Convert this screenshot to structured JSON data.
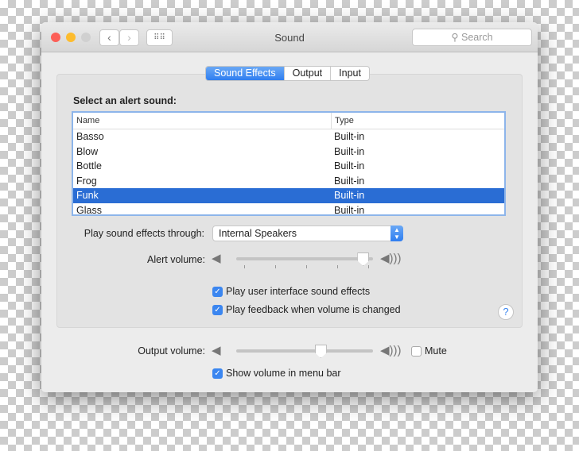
{
  "window": {
    "title": "Sound",
    "search_placeholder": "Search"
  },
  "tabs": [
    {
      "label": "Sound Effects",
      "selected": true
    },
    {
      "label": "Output",
      "selected": false
    },
    {
      "label": "Input",
      "selected": false
    }
  ],
  "alert": {
    "heading": "Select an alert sound:",
    "columns": [
      "Name",
      "Type"
    ],
    "rows": [
      [
        "Basso",
        "Built-in"
      ],
      [
        "Blow",
        "Built-in"
      ],
      [
        "Bottle",
        "Built-in"
      ],
      [
        "Frog",
        "Built-in"
      ],
      [
        "Funk",
        "Built-in"
      ],
      [
        "Glass",
        "Built-in"
      ]
    ],
    "selected": "Funk"
  },
  "play_through": {
    "label": "Play sound effects through:",
    "value": "Internal Speakers"
  },
  "alert_volume": {
    "label": "Alert volume:",
    "value": 0.97
  },
  "checks": {
    "ui_sounds": {
      "label": "Play user interface sound effects",
      "checked": true
    },
    "feedback": {
      "label": "Play feedback when volume is changed",
      "checked": true
    }
  },
  "help": "?",
  "output_volume": {
    "label": "Output volume:",
    "value": 0.63
  },
  "mute": {
    "label": "Mute",
    "checked": false
  },
  "show_volume": {
    "label": "Show volume in menu bar",
    "checked": true
  },
  "colors": {
    "accent": "#2f7ef0",
    "selection": "#2a6dd4"
  }
}
